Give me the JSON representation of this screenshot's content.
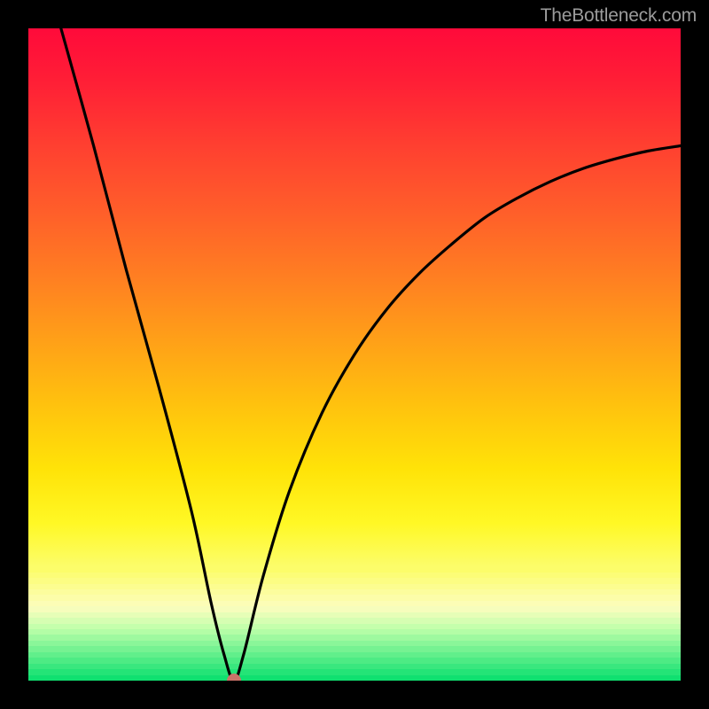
{
  "watermark": "TheBottleneck.com",
  "colors": {
    "frame": "#000000",
    "curve": "#000000",
    "dot": "#cb7369",
    "green": "#10e070"
  },
  "chart_data": {
    "type": "line",
    "title": "",
    "xlabel": "",
    "ylabel": "",
    "xlim": [
      0,
      100
    ],
    "ylim": [
      0,
      100
    ],
    "series": [
      {
        "name": "bottleneck-curve",
        "x": [
          5,
          10,
          15,
          20,
          25,
          28,
          30,
          31.5,
          33,
          36,
          40,
          45,
          50,
          55,
          60,
          65,
          70,
          75,
          80,
          85,
          90,
          95,
          100
        ],
        "y": [
          100,
          82,
          63,
          45,
          26,
          12,
          4,
          0,
          4,
          16,
          29,
          41,
          50,
          57,
          62.5,
          67,
          71,
          74,
          76.5,
          78.5,
          80,
          81.2,
          82
        ]
      }
    ],
    "annotations": [
      {
        "name": "optimal-point",
        "x": 31.5,
        "y": 0
      }
    ],
    "background_bands": [
      {
        "name": "red",
        "y_from": 100,
        "y_to": 70,
        "color_top": "#ff0a3a",
        "color_bottom": "#ff7e22"
      },
      {
        "name": "orange",
        "y_from": 70,
        "y_to": 35,
        "color_top": "#ff7e22",
        "color_bottom": "#ffe308"
      },
      {
        "name": "yellow",
        "y_from": 35,
        "y_to": 17,
        "color_top": "#ffe308",
        "color_bottom": "#fcfd6a"
      },
      {
        "name": "pale-yellow",
        "y_from": 17,
        "y_to": 8,
        "color_top": "#fcfd6a",
        "color_bottom": "#fbffb2"
      },
      {
        "name": "green",
        "y_from": 8,
        "y_to": 0,
        "color_top": "#adfca0",
        "color_bottom": "#10e070"
      }
    ]
  }
}
